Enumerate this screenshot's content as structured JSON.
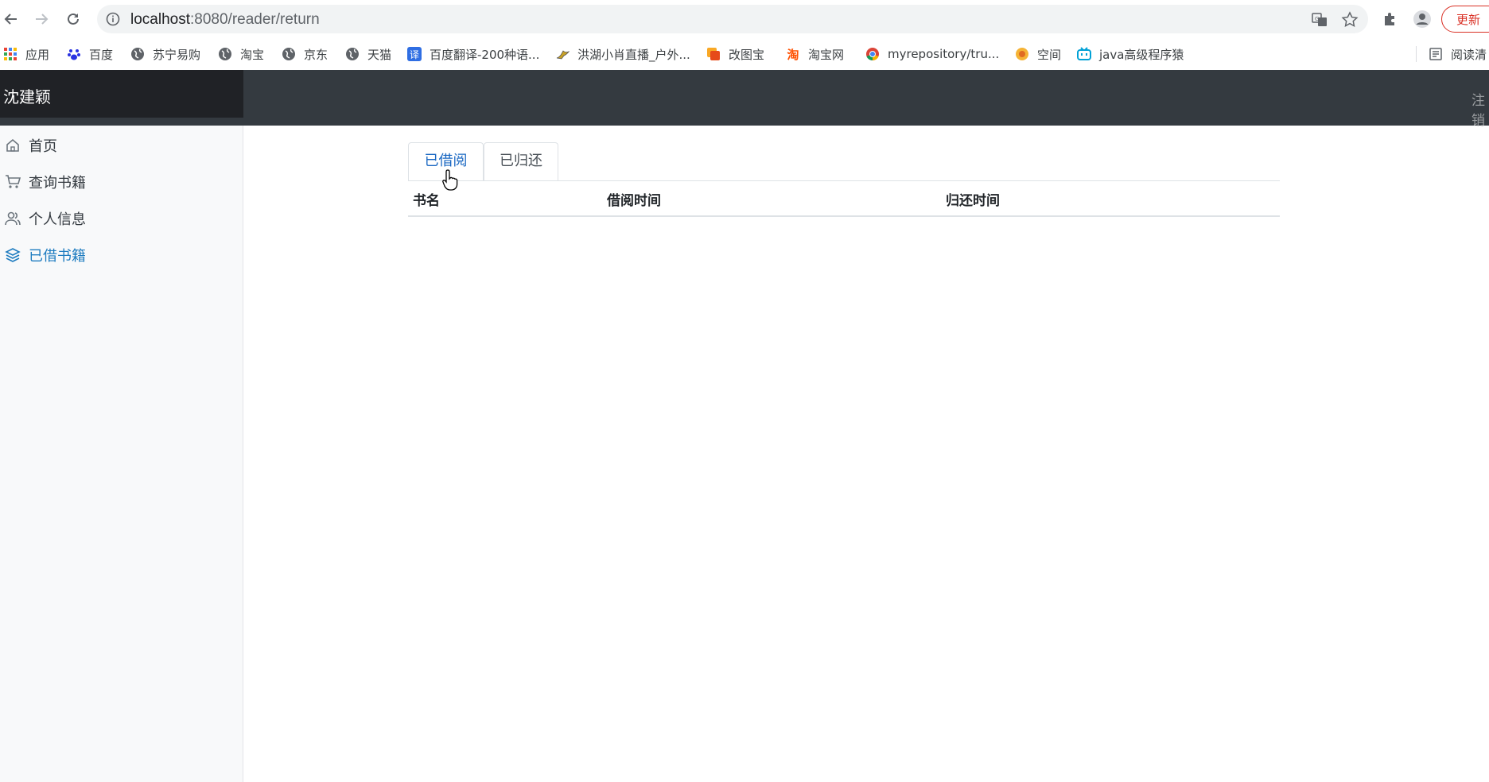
{
  "browser": {
    "url_host": "localhost",
    "url_rest": ":8080/reader/return",
    "update_label": "更新"
  },
  "bookmarks": [
    {
      "label": "应用",
      "icon": "apps-grid-icon"
    },
    {
      "label": "百度",
      "icon": "baidu-paw-icon"
    },
    {
      "label": "苏宁易购",
      "icon": "globe-icon"
    },
    {
      "label": "淘宝",
      "icon": "globe-icon"
    },
    {
      "label": "京东",
      "icon": "globe-icon"
    },
    {
      "label": "天猫",
      "icon": "globe-icon"
    },
    {
      "label": "百度翻译-200种语...",
      "icon": "translate-icon"
    },
    {
      "label": "洪湖小肖直播_户外...",
      "icon": "bird-icon"
    },
    {
      "label": "改图宝",
      "icon": "orange-square-icon"
    },
    {
      "label": "淘宝网",
      "icon": "taobao-icon"
    },
    {
      "label": "myrepository/tru...",
      "icon": "chrome-icon"
    },
    {
      "label": "空间",
      "icon": "qzone-icon"
    },
    {
      "label": "java高级程序猿",
      "icon": "bilibili-icon"
    },
    {
      "label": "阅读清",
      "icon": "reading-list-icon"
    }
  ],
  "app": {
    "brand": "沈建颖",
    "topnav_right": "注销"
  },
  "sidebar": {
    "items": [
      {
        "label": "首页",
        "icon": "home-icon",
        "active": false
      },
      {
        "label": "查询书籍",
        "icon": "cart-icon",
        "active": false
      },
      {
        "label": "个人信息",
        "icon": "users-icon",
        "active": false
      },
      {
        "label": "已借书籍",
        "icon": "layers-icon",
        "active": true
      }
    ]
  },
  "tabs": [
    {
      "label": "已借阅",
      "active": true
    },
    {
      "label": "已归还",
      "active": false
    }
  ],
  "table": {
    "columns": [
      "书名",
      "借阅时间",
      "归还时间"
    ],
    "rows": []
  },
  "colors": {
    "active_link": "#1e7cc0",
    "topnav": "#343a40",
    "brand_bg": "#202226",
    "update_red": "#d93025"
  }
}
